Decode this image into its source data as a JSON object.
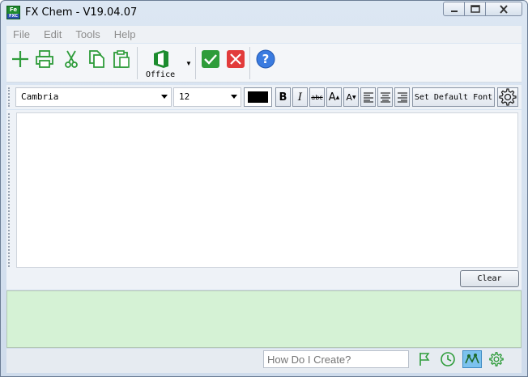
{
  "window": {
    "title": "FX Chem - V19.04.07",
    "app_icon_text": "Fe",
    "app_icon_sub": "FXC"
  },
  "window_controls": {
    "minimize": "—",
    "maximize": "□",
    "close": "✕"
  },
  "menu": {
    "items": [
      "File",
      "Edit",
      "Tools",
      "Help"
    ]
  },
  "toolbar": {
    "icons": [
      "new-icon",
      "print-icon",
      "cut-icon",
      "copy-icon",
      "paste-icon",
      "office-icon",
      "accept-icon",
      "cancel-icon",
      "help-icon"
    ],
    "office_label": "Office",
    "office_caret": "▼"
  },
  "fontbar": {
    "font_name": "Cambria",
    "font_size": "12",
    "text_color": "#000000",
    "bold": "B",
    "italic": "I",
    "strike": "abc",
    "increase": "A",
    "decrease": "A",
    "set_default_font": "Set Default Font"
  },
  "editor": {
    "content": "",
    "clear_label": "Clear"
  },
  "status": {
    "search_placeholder": "How Do I Create?",
    "icons": [
      "flag-icon",
      "history-icon",
      "structure-icon",
      "settings-icon"
    ]
  },
  "colors": {
    "green_accent": "#2e9c3a",
    "output_background": "#d5f2d5",
    "help_blue": "#3a7be0",
    "cancel_red": "#e23b3b"
  }
}
